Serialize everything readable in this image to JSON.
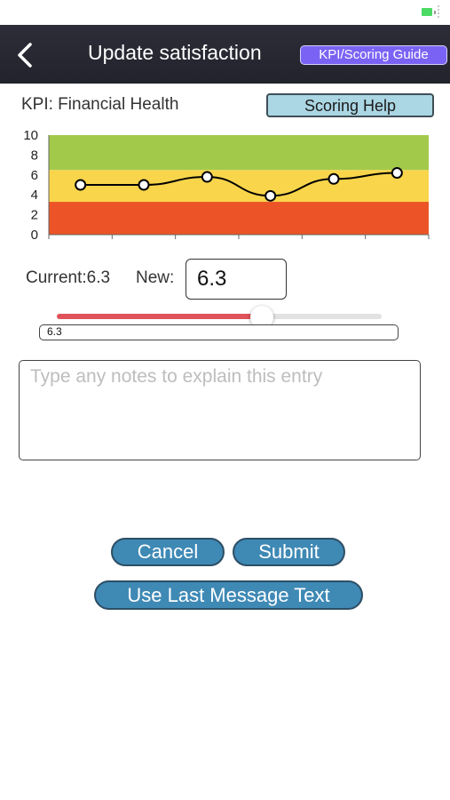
{
  "status_bar": {
    "battery_icon": "battery-icon"
  },
  "header": {
    "back_icon": "chevron-left-icon",
    "title": "Update satisfaction",
    "guide_button": "KPI/Scoring Guide"
  },
  "kpi": {
    "label": "KPI: Financial Health",
    "help_button": "Scoring Help"
  },
  "chart_data": {
    "type": "line",
    "title": "",
    "xlabel": "",
    "ylabel": "",
    "ylim": [
      0,
      10
    ],
    "yticks": [
      "0",
      "2",
      "4",
      "6",
      "8",
      "10"
    ],
    "bands": [
      {
        "from": 0,
        "to": 3.3,
        "color": "#ec5427"
      },
      {
        "from": 3.3,
        "to": 6.5,
        "color": "#f9d54b"
      },
      {
        "from": 6.5,
        "to": 10,
        "color": "#a3c94b"
      }
    ],
    "series": [
      {
        "values": [
          5.0,
          5.0,
          5.8,
          3.9,
          5.6,
          6.2
        ]
      }
    ],
    "grid": false,
    "legend": "none"
  },
  "entry": {
    "current_label": "Current:6.3",
    "new_label": "New:",
    "new_value": "6.3"
  },
  "slider": {
    "min": 0,
    "max": 10,
    "value": 6.3,
    "value_text": "6.3",
    "fill_color": "#e0535a"
  },
  "notes": {
    "placeholder": "Type any notes to explain this entry"
  },
  "actions": {
    "cancel": "Cancel",
    "submit": "Submit",
    "use_last": "Use Last Message Text"
  },
  "colors": {
    "navbar": "#262730",
    "accent_purple": "#7a63f4",
    "button_blue": "#3f89b5",
    "help_blue": "#abd6e3"
  }
}
